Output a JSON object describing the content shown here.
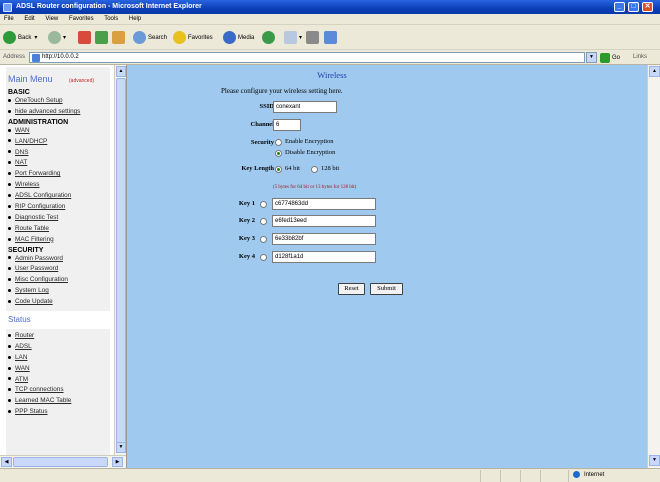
{
  "window": {
    "title": "ADSL Router configuration - Microsoft Internet Explorer"
  },
  "menubar": [
    "File",
    "Edit",
    "View",
    "Favorites",
    "Tools",
    "Help"
  ],
  "toolbar": {
    "back": "Back",
    "search": "Search",
    "favorites": "Favorites",
    "media": "Media"
  },
  "address": {
    "label": "Address",
    "url": "http://10.0.0.2",
    "go": "Go",
    "links": "Links"
  },
  "left_menu": {
    "title": "Main Menu",
    "power_label": "(advanced)",
    "sections": [
      {
        "header": "BASIC",
        "items": [
          "OneTouch Setup",
          "hide advanced settings"
        ]
      },
      {
        "header": "ADMINISTRATION",
        "items": [
          "WAN",
          "LAN/DHCP",
          "DNS",
          "NAT",
          "Port Forwarding",
          "Wireless",
          "ADSL Configuration",
          "RIP Configuration",
          "Diagnostic Test",
          "Route Table",
          "MAC Filtering"
        ]
      },
      {
        "header": "SECURITY",
        "items": [
          "Admin Password",
          "User Password",
          "Misc Configuration",
          "System Log",
          "Code Update"
        ]
      }
    ],
    "status_header": "Status",
    "status_items": [
      "Router",
      "ADSL",
      "LAN",
      "WAN",
      "ATM",
      "TCP connections",
      "Learned MAC Table",
      "PPP Status"
    ]
  },
  "wireless": {
    "title": "Wireless",
    "intro": "Please configure your wireless setting here.",
    "ssid_label": "SSID",
    "ssid_value": "conexant",
    "channel_label": "Channel",
    "channel_value": "6",
    "security_label": "Security",
    "enable_label": "Enable Encryption",
    "disable_label": "Disable Encryption",
    "keylength_label": "Key Length",
    "bit64_label": "64 bit",
    "bit128_label": "128 bit",
    "key_hint": "(5 bytes for 64 bit or 13 bytes for 128 bit)",
    "keys": [
      {
        "label": "Key 1",
        "value": "c6774863dd"
      },
      {
        "label": "Key 2",
        "value": "e6fed13eed"
      },
      {
        "label": "Key 3",
        "value": "6e33b82bf"
      },
      {
        "label": "Key 4",
        "value": "d128f1a1d"
      }
    ],
    "reset_label": "Reset",
    "submit_label": "Submit"
  },
  "statusbar": {
    "zone": "Internet"
  }
}
